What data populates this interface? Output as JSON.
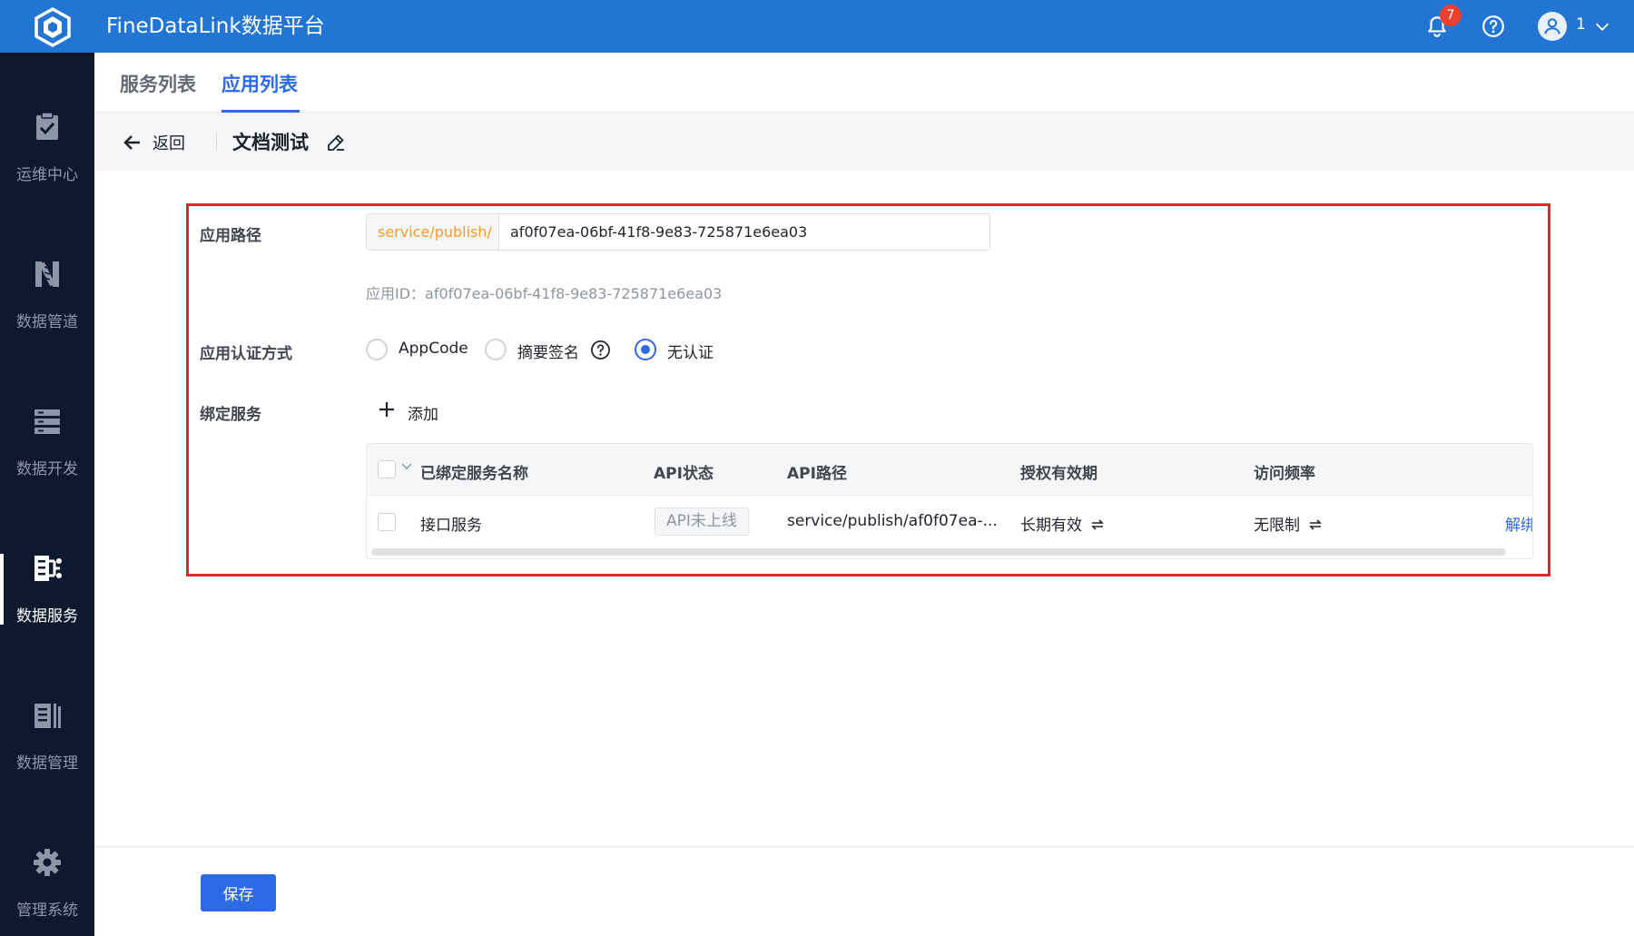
{
  "topbar": {
    "title": "FineDataLink数据平台",
    "notification_count": "7",
    "user_name": "1"
  },
  "sidebar": {
    "items": [
      {
        "label": "运维中心",
        "icon": "ops-checklist-icon"
      },
      {
        "label": "数据管道",
        "icon": "pipeline-icon"
      },
      {
        "label": "数据开发",
        "icon": "dev-stack-icon"
      },
      {
        "label": "数据服务",
        "icon": "service-icon",
        "active": true
      },
      {
        "label": "数据管理",
        "icon": "manage-books-icon"
      },
      {
        "label": "管理系统",
        "icon": "gear-icon"
      }
    ]
  },
  "tabs": [
    {
      "label": "服务列表",
      "active": false
    },
    {
      "label": "应用列表",
      "active": true
    }
  ],
  "subheader": {
    "back_label": "返回",
    "doc_title": "文档测试"
  },
  "form": {
    "path_label": "应用路径",
    "path_prefix": "service/publish/",
    "path_value": "af0f07ea-06bf-41f8-9e83-725871e6ea03",
    "app_id_text": "应用ID：af0f07ea-06bf-41f8-9e83-725871e6ea03",
    "auth_label": "应用认证方式",
    "auth_options": [
      {
        "label": "AppCode",
        "checked": false
      },
      {
        "label": "摘要签名",
        "checked": false
      },
      {
        "label": "无认证",
        "checked": true
      }
    ],
    "bind_label": "绑定服务",
    "add_label": "添加"
  },
  "table": {
    "headers": [
      "已绑定服务名称",
      "API状态",
      "API路径",
      "授权有效期",
      "访问频率"
    ],
    "rows": [
      {
        "name": "接口服务",
        "status": "API未上线",
        "path": "service/publish/af0f07ea-...",
        "validity": "长期有效",
        "frequency": "无限制",
        "action": "解绑"
      }
    ]
  },
  "footer": {
    "save_label": "保存"
  },
  "colors": {
    "brand": "#2375d3",
    "primary": "#2c6ae6",
    "sidebar": "#0d1a2e",
    "highlight": "#e5252c",
    "prefix": "#f29a2a"
  }
}
